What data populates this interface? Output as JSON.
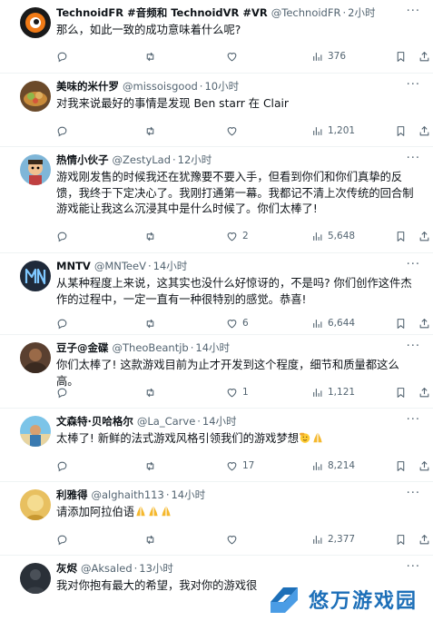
{
  "theme": {
    "text": "#0f1419",
    "muted": "#536471",
    "divider": "#eff3f4",
    "watermark": "#1d6fb8"
  },
  "more_label": "···",
  "tweets": [
    {
      "name": "TechnoidFR #音频和 TechnoidVR #VR",
      "handle": "@TechnoidFR",
      "time": "2小时",
      "text": "那么，如此一致的成功意味着什么呢?",
      "replies": "",
      "retweets": "",
      "likes": "",
      "views": "376",
      "avatar_icon": "orange-eye-avatar"
    },
    {
      "name": "美味的米什罗",
      "handle": "@missoisgood",
      "time": "10小时",
      "text": "对我来说最好的事情是发现 Ben starr 在 Clair",
      "replies": "",
      "retweets": "",
      "likes": "",
      "views": "1,201",
      "avatar_icon": "food-bowl-avatar"
    },
    {
      "name": "热情小伙子",
      "handle": "@ZestyLad",
      "time": "12小时",
      "text": "游戏刚发售的时候我还在犹豫要不要入手，但看到你们和你们真挚的反馈，我终于下定决心了。我刚打通第一幕。我都记不清上次传统的回合制游戏能让我这么沉浸其中是什么时候了。你们太棒了!",
      "replies": "",
      "retweets": "",
      "likes": "2",
      "views": "5,648",
      "avatar_icon": "cartoon-character-avatar"
    },
    {
      "name": "MNTV",
      "handle": "@MNTeeV",
      "time": "14小时",
      "text": "从某种程度上来说，这其实也没什么好惊讶的，不是吗? 你们创作这件杰作的过程中，一定一直有一种很特别的感觉。恭喜!",
      "replies": "",
      "retweets": "",
      "likes": "6",
      "views": "6,644",
      "avatar_icon": "mn-logo-avatar"
    },
    {
      "name": "豆子@金碟",
      "handle": "@TheoBeantjb",
      "time": "14小时",
      "text": "你们太棒了! 这款游戏目前为止才开发到这个程度，细节和质量都这么高。",
      "replies": "",
      "retweets": "",
      "likes": "1",
      "views": "1,121",
      "avatar_icon": "portrait-avatar"
    },
    {
      "name": "文森特·贝哈格尔",
      "handle": "@La_Carve",
      "time": "14小时",
      "text": "太棒了! 新鲜的法式游戏风格引领我们的游戏梦想",
      "emojis": [
        "face-salute-emoji",
        "folded-hands-emoji"
      ],
      "replies": "",
      "retweets": "",
      "likes": "17",
      "views": "8,214",
      "avatar_icon": "beach-avatar"
    },
    {
      "name": "利雅得",
      "handle": "@alghaith113",
      "time": "14小时",
      "text": "请添加阿拉伯语",
      "emojis": [
        "folded-hands-emoji",
        "folded-hands-emoji",
        "folded-hands-emoji"
      ],
      "replies": "",
      "retweets": "",
      "likes": "",
      "views": "2,377",
      "avatar_icon": "golden-avatar"
    },
    {
      "name": "灰烬",
      "handle": "@Aksaled",
      "time": "13小时",
      "text": "我对你抱有最大的希望，我对你的游戏很",
      "replies": "",
      "retweets": "",
      "likes": "",
      "views": "",
      "avatar_icon": "dark-figure-avatar"
    }
  ],
  "watermark": {
    "text": "悠万游戏园",
    "icon": "watermark-logo-icon"
  }
}
